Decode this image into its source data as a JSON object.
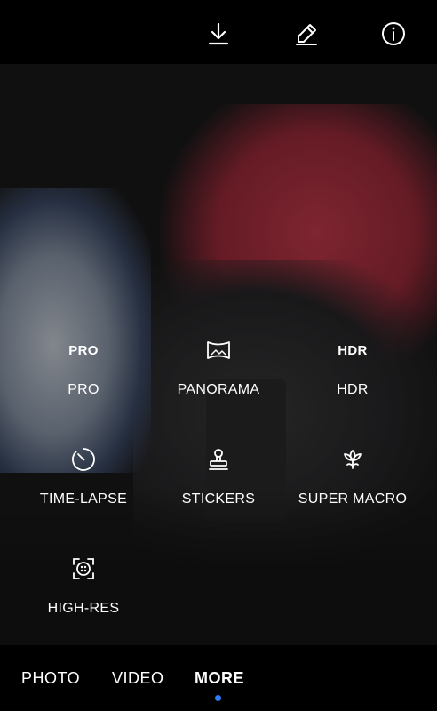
{
  "top_bar": {
    "download_icon": "download-icon",
    "edit_icon": "pencil-icon",
    "info_icon": "info-icon"
  },
  "modes": [
    {
      "label": "PRO",
      "icon_text": "PRO"
    },
    {
      "label": "PANORAMA",
      "icon": "panorama-icon"
    },
    {
      "label": "HDR",
      "icon_text": "HDR"
    },
    {
      "label": "TIME-LAPSE",
      "icon": "timer-icon"
    },
    {
      "label": "STICKERS",
      "icon": "stamp-icon"
    },
    {
      "label": "SUPER MACRO",
      "icon": "flower-icon"
    },
    {
      "label": "HIGH-RES",
      "icon": "high-res-icon"
    }
  ],
  "bottom_tabs": [
    {
      "label": "PHOTO"
    },
    {
      "label": "VIDEO"
    },
    {
      "label": "MORE",
      "active": true
    }
  ],
  "colors": {
    "accent": "#2f7cf6",
    "background": "#000000"
  }
}
